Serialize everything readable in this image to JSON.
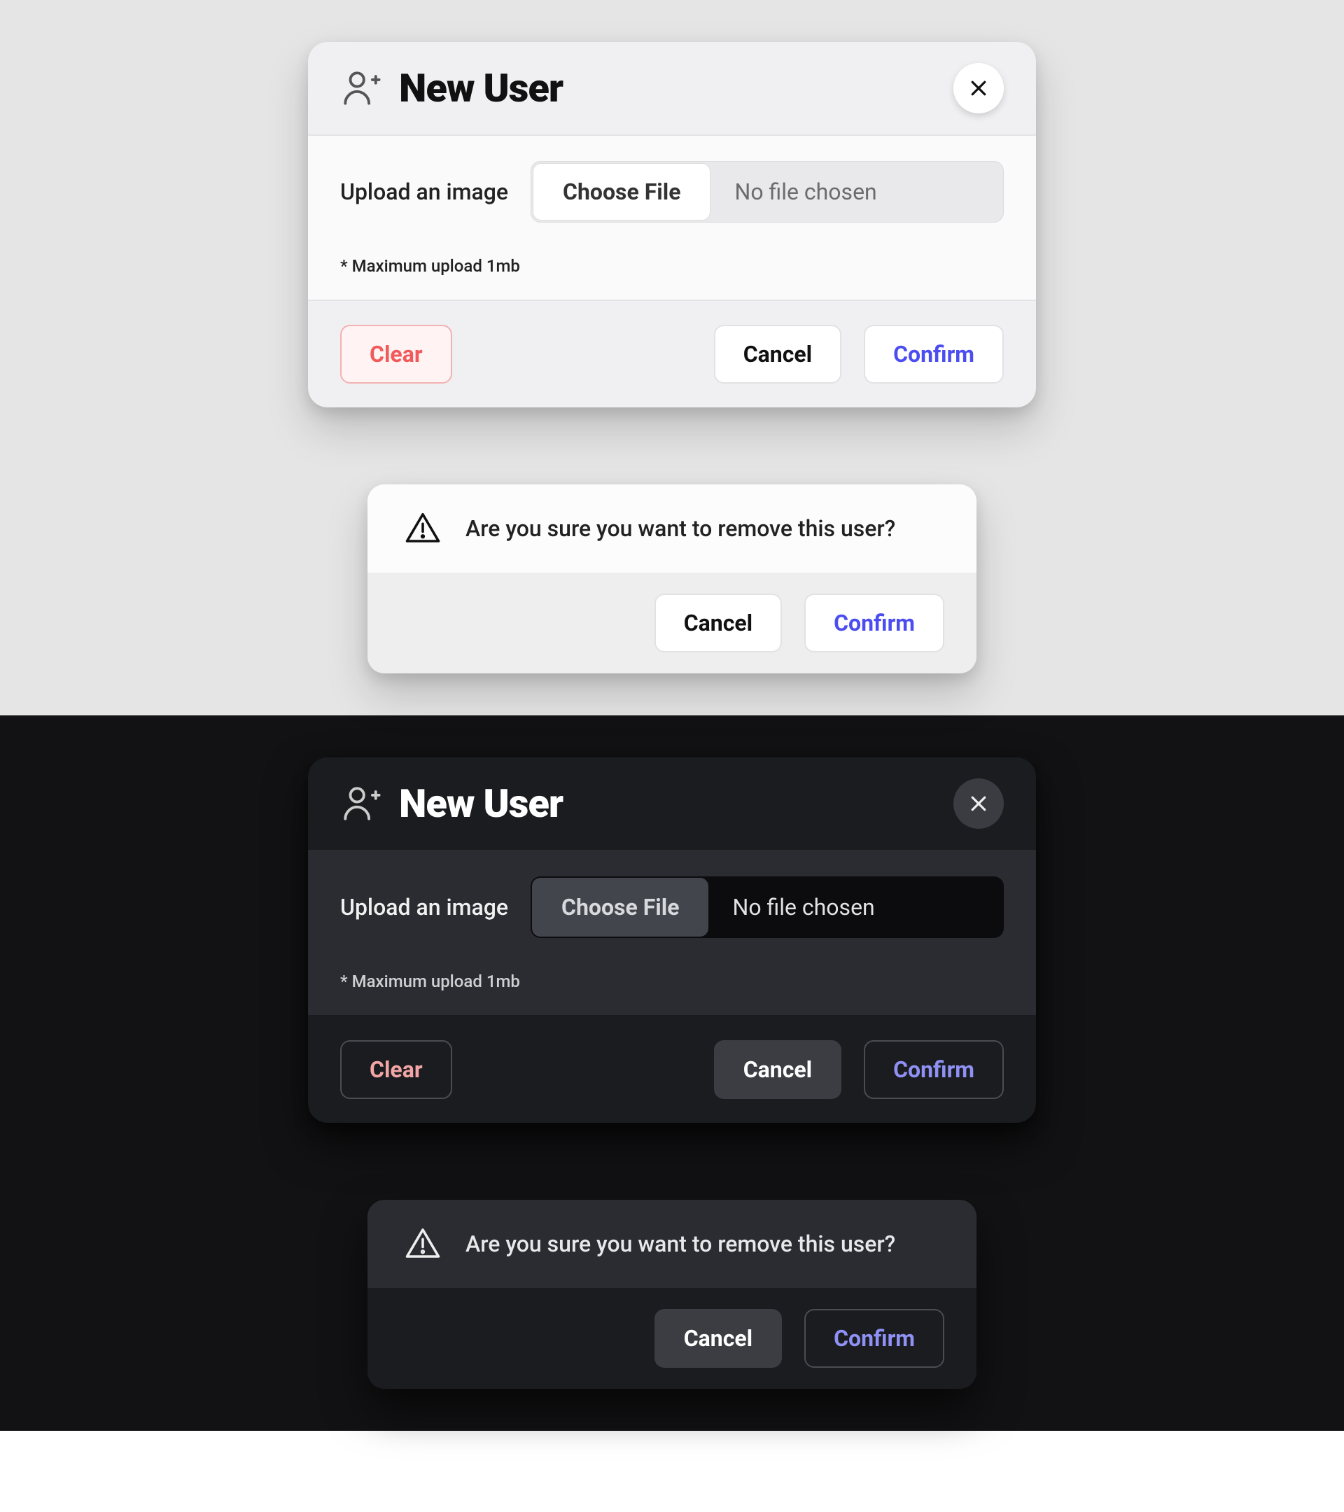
{
  "card": {
    "title": "New User",
    "upload_label": "Upload an image",
    "choose_file": "Choose File",
    "file_status": "No file chosen",
    "hint": "* Maximum upload 1mb",
    "clear": "Clear",
    "cancel": "Cancel",
    "confirm": "Confirm"
  },
  "mini": {
    "question": "Are you sure you want to remove this user?",
    "cancel": "Cancel",
    "confirm": "Confirm"
  },
  "colors": {
    "accent_blue": "#4b4df0",
    "danger_red": "#f05a5a"
  }
}
